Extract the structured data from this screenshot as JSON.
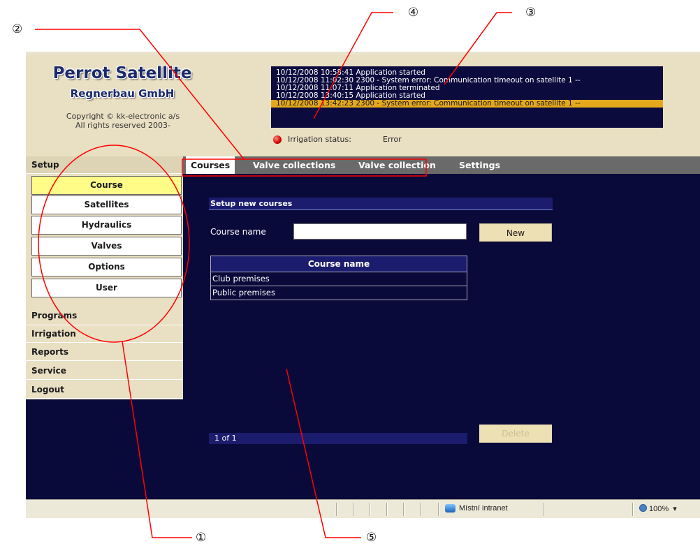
{
  "header": {
    "logo_line1": "Perrot Satellite",
    "logo_line2": "Regnerbau GmbH",
    "copyright_line1": "Copyright © kk-electronic a/s",
    "copyright_line2": "All rights reserved 2003-"
  },
  "log": [
    "10/12/2008 10:58:41 Application started",
    "10/12/2008 11:02:30 2300 - System error: Communication timeout on satellite 1 --",
    "10/12/2008 11:07:11 Application terminated",
    "10/12/2008 13:40:15 Application started",
    "10/12/2008 13:42:23 2300 - System error: Communication timeout on satellite 1 --"
  ],
  "log_selected_index": 4,
  "irrigation_status": {
    "label": "Irrigation status:",
    "value": "Error",
    "indicator_color": "#d00000"
  },
  "menu": {
    "setup": "Setup",
    "setup_items": [
      "Course",
      "Satellites",
      "Hydraulics",
      "Valves",
      "Options",
      "User"
    ],
    "active_item": "Course",
    "categories": [
      "Programs",
      "Irrigation",
      "Reports",
      "Service",
      "Logout"
    ]
  },
  "tabs": [
    "Courses",
    "Valve collections",
    "Valve collection",
    "Settings"
  ],
  "active_tab": "Courses",
  "content": {
    "title": "Setup new courses",
    "course_name_label": "Course name",
    "course_name_value": "",
    "new_button": "New",
    "table_header": "Course name",
    "rows": [
      "Club premises",
      "Public premises"
    ],
    "pager": "1 of 1",
    "delete_button": "Delete"
  },
  "statusbar": {
    "zone": "Místní intranet",
    "zoom": "100%",
    "zoom_caret": "▾"
  },
  "callouts": [
    "①",
    "②",
    "③",
    "④",
    "⑤"
  ],
  "colors": {
    "background": "#0a0a3a",
    "panel": "#e9dfc3",
    "active_item": "#fffc88",
    "log_selected": "#e3a81c",
    "callout_line": "#ff0000"
  }
}
